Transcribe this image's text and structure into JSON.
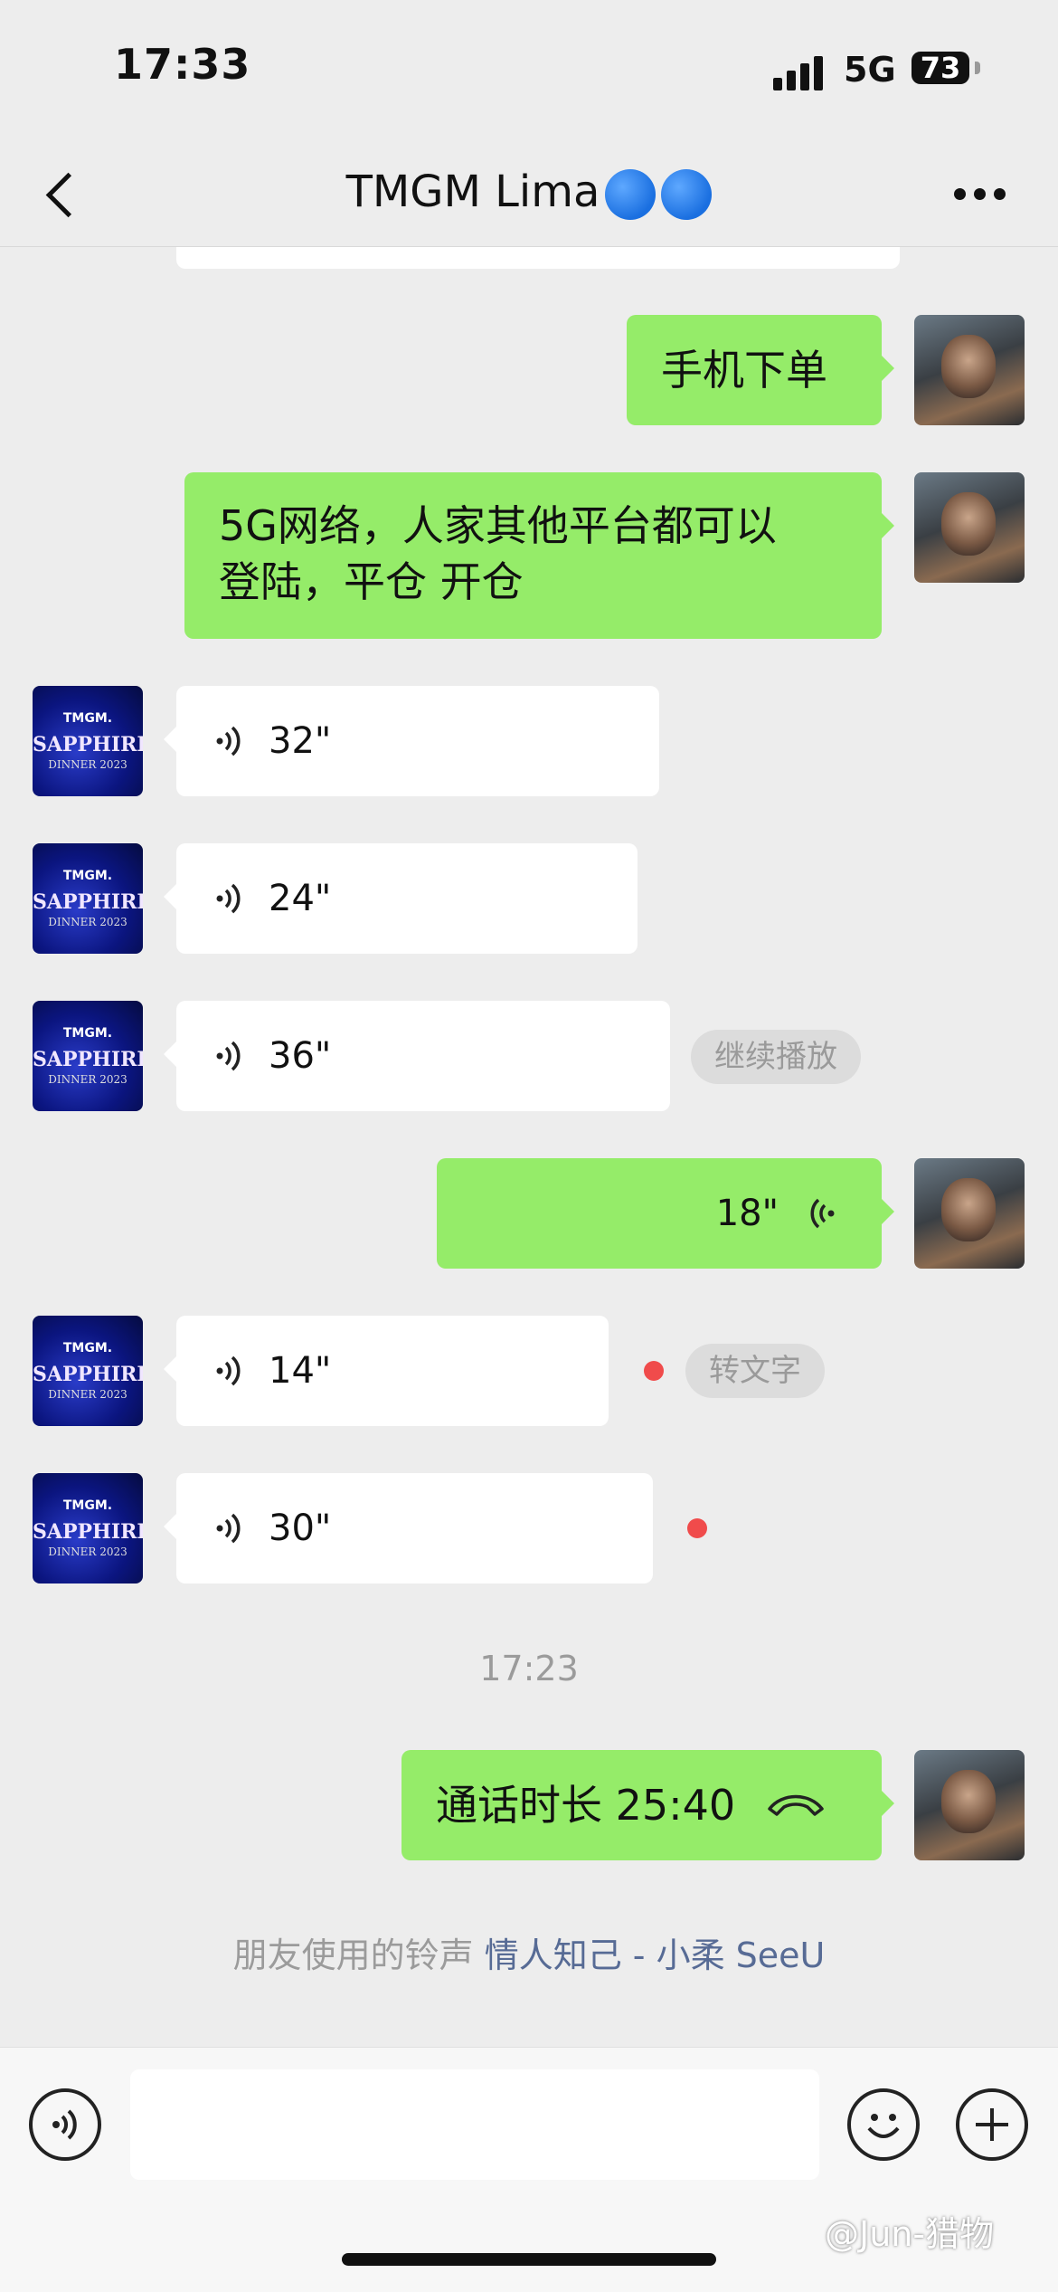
{
  "status_bar": {
    "time": "17:33",
    "network": "5G",
    "battery": "73"
  },
  "nav": {
    "title": "TMGM Lima",
    "back_icon": "chevron-left-icon",
    "more_icon": "more-dots-icon"
  },
  "contact_avatar": {
    "line1": "TMGM.",
    "line2": "SAPPHIRE",
    "line3": "DINNER 2023"
  },
  "messages": [
    {
      "from": "me",
      "type": "text",
      "text": "手机下单"
    },
    {
      "from": "me",
      "type": "text",
      "line1": "5G网络，人家其他平台都可以",
      "line2": "登陆，平仓 开仓"
    },
    {
      "from": "other",
      "type": "voice",
      "duration": "32\""
    },
    {
      "from": "other",
      "type": "voice",
      "duration": "24\""
    },
    {
      "from": "other",
      "type": "voice",
      "duration": "36\"",
      "action": "继续播放"
    },
    {
      "from": "me",
      "type": "voice",
      "duration": "18\""
    },
    {
      "from": "other",
      "type": "voice",
      "duration": "14\"",
      "unread": true,
      "action": "转文字"
    },
    {
      "from": "other",
      "type": "voice",
      "duration": "30\"",
      "unread": true
    }
  ],
  "timestamp": "17:23",
  "call": {
    "text": "通话时长 25:40",
    "icon": "phone-hangup-icon"
  },
  "ringtone": {
    "prefix": "朋友使用的铃声",
    "song": "情人知己 - 小柔 SeeU"
  },
  "input_bar": {
    "voice_icon": "voice-mode-icon",
    "emoji_icon": "emoji-icon",
    "plus_icon": "plus-icon"
  },
  "watermark": "@Jun-猎物",
  "colors": {
    "self_bubble": "#95ec69",
    "other_bubble": "#ffffff",
    "background": "#ededed",
    "unread_dot": "#f04b4b",
    "link": "#576b95"
  }
}
